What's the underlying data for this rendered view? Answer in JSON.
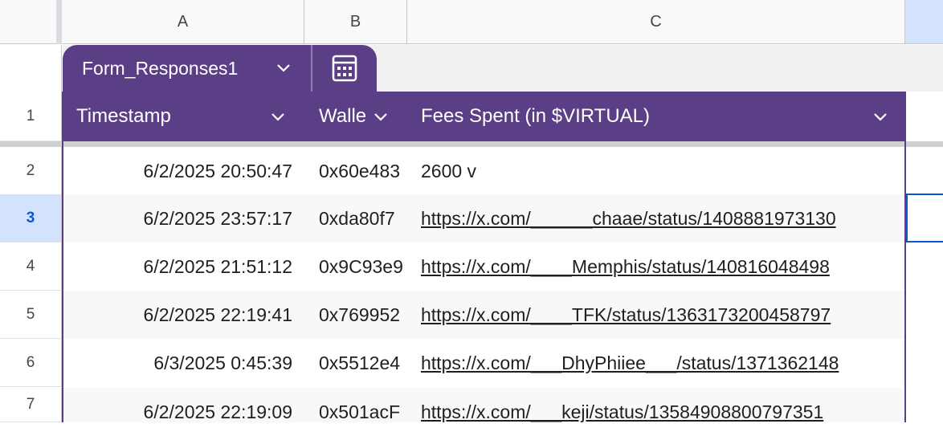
{
  "columns": [
    "A",
    "B",
    "C"
  ],
  "table": {
    "name": "Form_Responses1",
    "headers": [
      "Timestamp",
      "Walle",
      "Fees Spent (in $VIRTUAL)"
    ]
  },
  "header_row_number": "1",
  "rows": [
    {
      "num": "2",
      "timestamp": "6/2/2025 20:50:47",
      "wallet": "0x60e483",
      "fees": "2600 v"
    },
    {
      "num": "3",
      "timestamp": "6/2/2025 23:57:17",
      "wallet": "0xda80f7",
      "fees": "https://x.com/______chaae/status/1408881973130"
    },
    {
      "num": "4",
      "timestamp": "6/2/2025 21:51:12",
      "wallet": "0x9C93e9",
      "fees": "https://x.com/____Memphis/status/140816048498"
    },
    {
      "num": "5",
      "timestamp": "6/2/2025 22:19:41",
      "wallet": "0x769952",
      "fees": "https://x.com/____TFK/status/1363173200458797"
    },
    {
      "num": "6",
      "timestamp": "6/3/2025 0:45:39",
      "wallet": "0x5512e4",
      "fees": "https://x.com/___DhyPhiiee___/status/1371362148"
    },
    {
      "num": "7",
      "timestamp": "6/2/2025 22:19:09",
      "wallet": "0x501acF",
      "fees": "https://x.com/___keji/status/13584908800797351"
    }
  ],
  "selected_row": "3",
  "colors": {
    "table_header": "#5b3f86",
    "selection": "#0b57d0",
    "selected_header_bg": "#d3e3fd"
  }
}
